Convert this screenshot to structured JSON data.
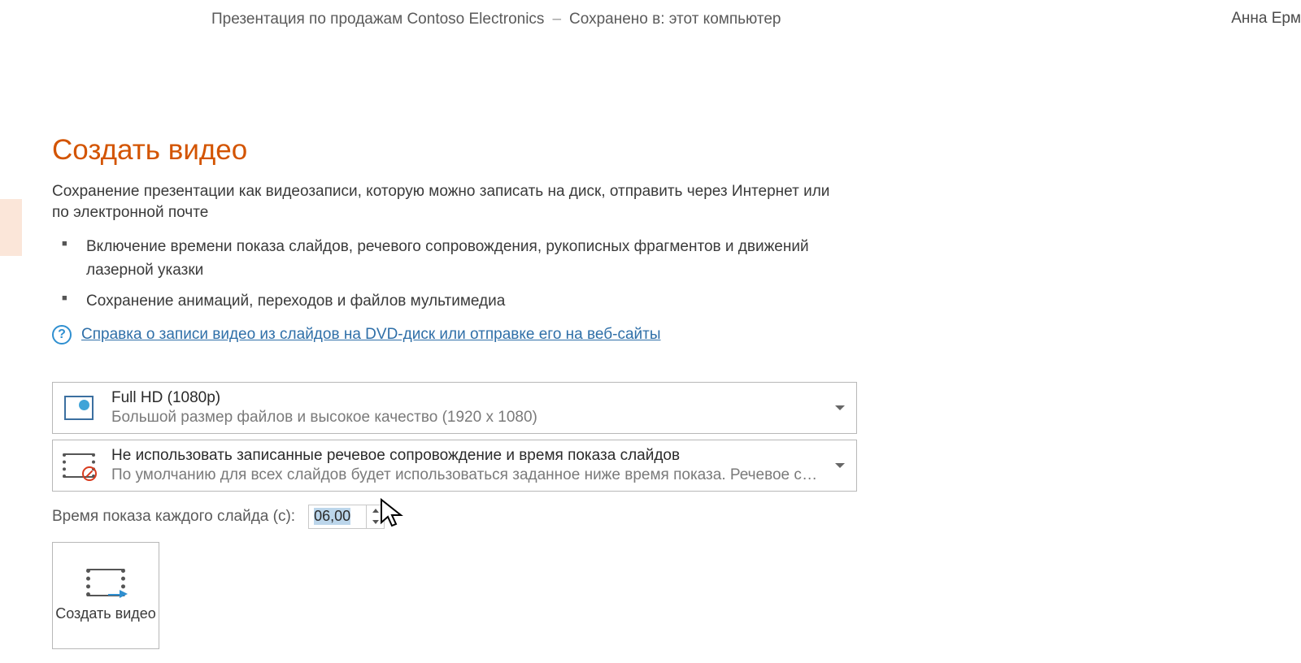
{
  "titlebar": {
    "doc_title": "Презентация по продажам Contoso Electronics",
    "separator": "–",
    "saved_to": "Сохранено в: этот компьютер",
    "user_name": "Анна Ерм"
  },
  "page": {
    "title": "Создать видео",
    "subtitle": "Сохранение презентации как видеозаписи, которую можно записать на диск, отправить через Интернет или по электронной почте",
    "bullets": [
      "Включение времени показа слайдов, речевого сопровождения, рукописных фрагментов и движений лазерной указки",
      "Сохранение анимаций, переходов и файлов мультимедиа"
    ],
    "help_link": "Справка о записи видео из слайдов на DVD-диск или отправке его на веб-сайты"
  },
  "quality": {
    "title": "Full HD (1080p)",
    "desc": "Большой размер файлов и высокое качество (1920 x 1080)"
  },
  "narration": {
    "title": "Не использовать записанные речевое сопровождение и время показа слайдов",
    "desc": "По умолчанию для всех слайдов будет использоваться заданное ниже время показа. Речевое со..."
  },
  "seconds": {
    "label": "Время показа каждого слайда (с):",
    "value": "06,00"
  },
  "create_button": {
    "label": "Создать видео"
  }
}
